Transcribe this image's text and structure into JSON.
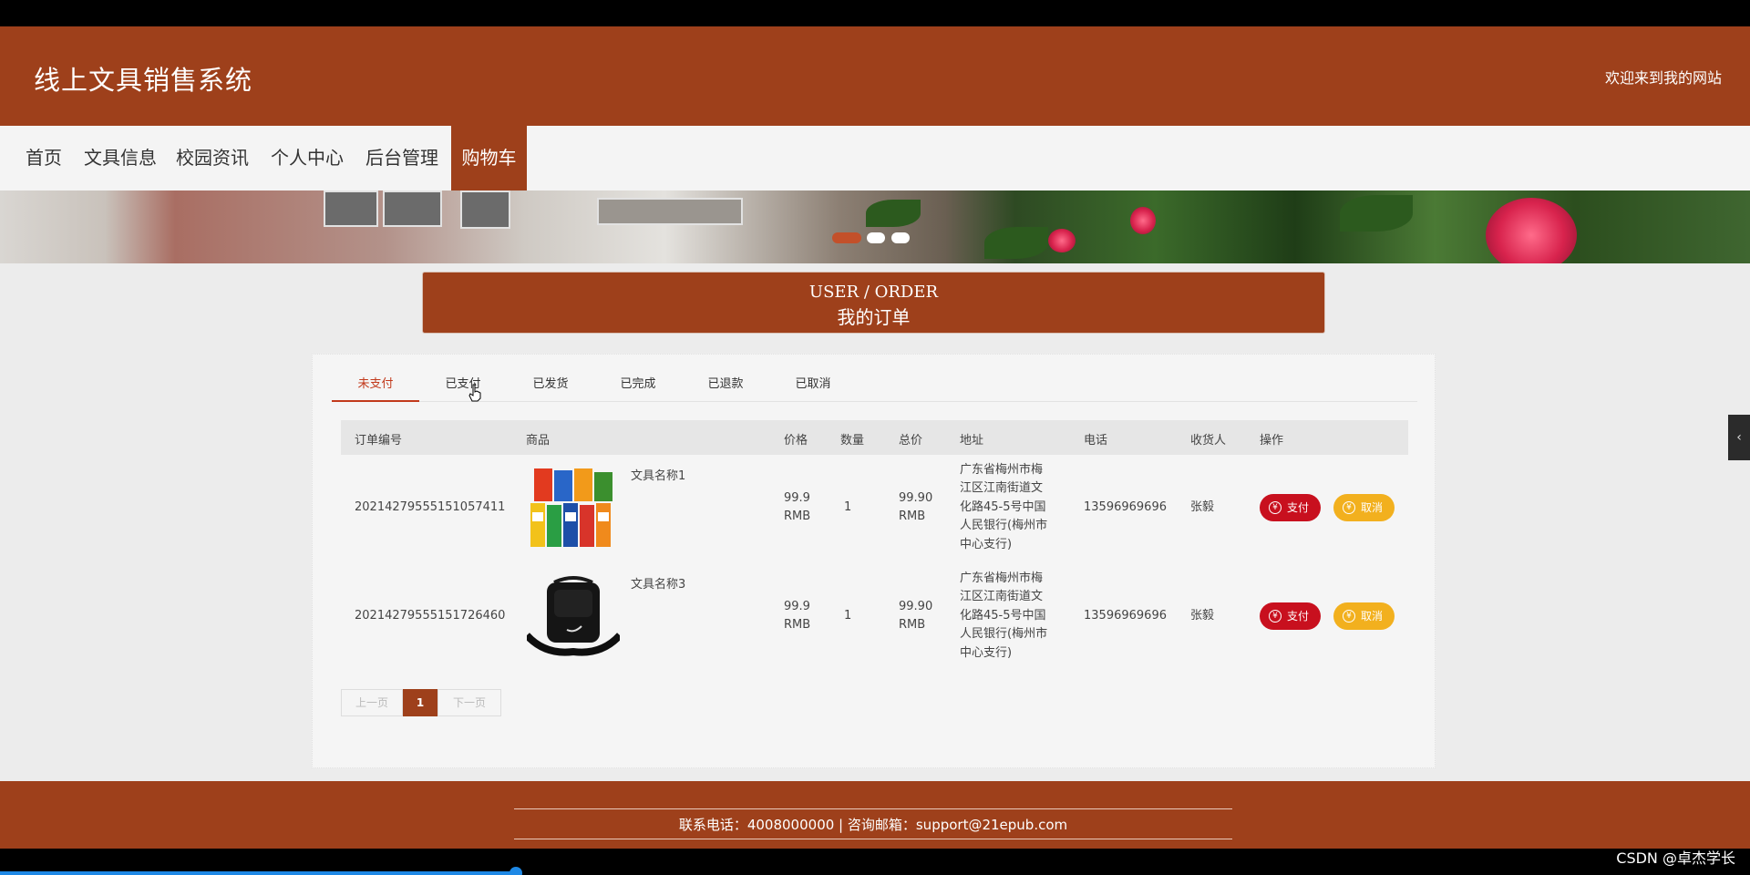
{
  "header": {
    "title": "线上文具销售系统",
    "welcome": "欢迎来到我的网站"
  },
  "nav": {
    "items": [
      {
        "label": "首页",
        "active": false
      },
      {
        "label": "文具信息",
        "active": false
      },
      {
        "label": "校园资讯",
        "active": false
      },
      {
        "label": "个人中心",
        "active": false
      },
      {
        "label": "后台管理",
        "active": false
      },
      {
        "label": "购物车",
        "active": true
      }
    ]
  },
  "banner": {
    "slide_count": 3,
    "active_slide": 1
  },
  "order_banner": {
    "title_en": "USER / ORDER",
    "title_cn": "我的订单"
  },
  "tabs": [
    {
      "label": "未支付",
      "active": true
    },
    {
      "label": "已支付",
      "active": false
    },
    {
      "label": "已发货",
      "active": false
    },
    {
      "label": "已完成",
      "active": false
    },
    {
      "label": "已退款",
      "active": false
    },
    {
      "label": "已取消",
      "active": false
    }
  ],
  "table": {
    "columns": [
      "订单编号",
      "商品",
      "价格",
      "数量",
      "总价",
      "地址",
      "电话",
      "收货人",
      "操作"
    ],
    "rows": [
      {
        "order_no": "20214279555151057411",
        "product_name": "文具名称1",
        "product_image": "snack-pack-image",
        "price_value": "99.9",
        "price_unit": "RMB",
        "quantity": "1",
        "total_value": "99.90",
        "total_unit": "RMB",
        "address_lines": [
          "广东省梅州市梅",
          "江区江南街道文",
          "化路45-5号中国",
          "人民银行(梅州市",
          "中心支行)"
        ],
        "phone": "13596969696",
        "receiver": "张毅",
        "pay_label": "支付",
        "cancel_label": "取消"
      },
      {
        "order_no": "20214279555151726460",
        "product_name": "文具名称3",
        "product_image": "black-bag-image",
        "price_value": "99.9",
        "price_unit": "RMB",
        "quantity": "1",
        "total_value": "99.90",
        "total_unit": "RMB",
        "address_lines": [
          "广东省梅州市梅",
          "江区江南街道文",
          "化路45-5号中国",
          "人民银行(梅州市",
          "中心支行)"
        ],
        "phone": "13596969696",
        "receiver": "张毅",
        "pay_label": "支付",
        "cancel_label": "取消"
      }
    ]
  },
  "pager": {
    "prev_label": "上一页",
    "current": "1",
    "next_label": "下一页"
  },
  "footer": {
    "contact": "联系电话：4008000000 | 咨询邮箱：support@21epub.com"
  },
  "side_tab": {
    "icon": "chevron-left-icon",
    "glyph": "‹"
  },
  "player": {
    "watermark": "CSDN @卓杰学长",
    "progress": 0.295
  },
  "colors": {
    "brand": "#9e401b",
    "pay": "#c8101e",
    "cancel": "#f2b01e",
    "tab_active": "#c23a1c"
  }
}
